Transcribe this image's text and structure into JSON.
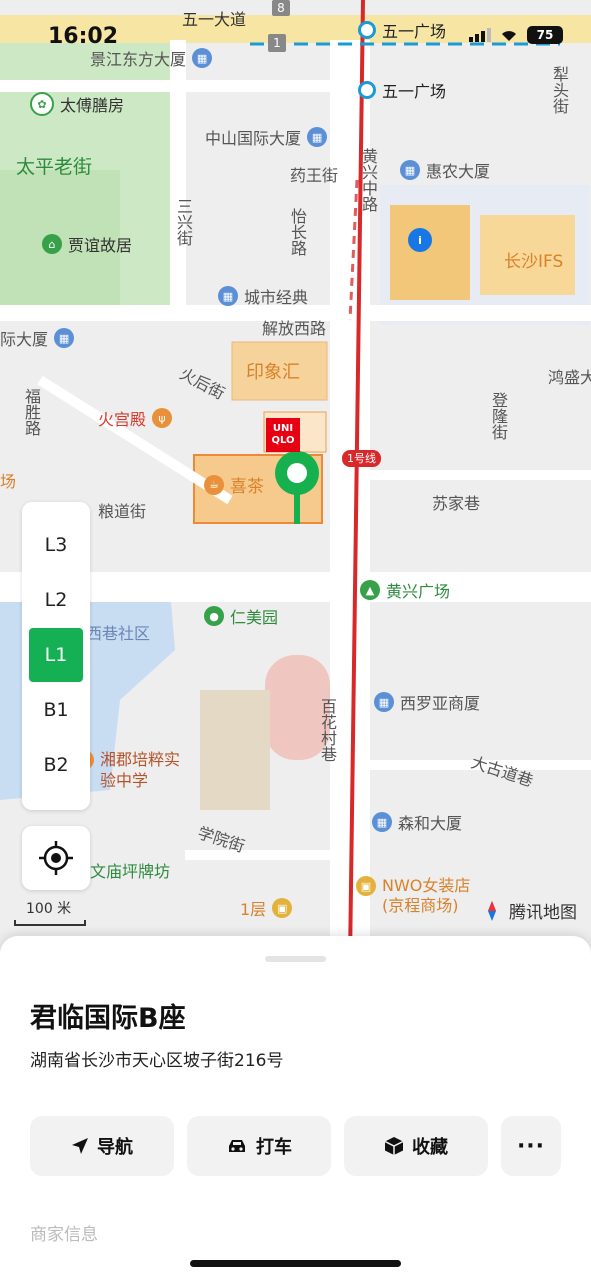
{
  "status_bar": {
    "time": "16:02",
    "battery": "75"
  },
  "map": {
    "roads": {
      "wuyi_road": "五一大道",
      "jiefang_west": "解放西路",
      "huangxing_middle": "黄兴中路",
      "yaowang": "药王街",
      "yichang": "怡长路",
      "sanxing": "三兴街",
      "huohou": "火后街",
      "fusheng": "福胜路",
      "liangdao": "粮道街",
      "dengzhong": "登隆街",
      "sujia": "苏家巷",
      "baihuacun": "百花村巷",
      "xueyuan": "学院街",
      "dagudao": "大古道巷",
      "litou": "犁头街",
      "line1": "1号线"
    },
    "pois": {
      "jingjiang": "景江东方大厦",
      "wuyi_square_1": "五一广场",
      "wuyi_square_2": "五一广场",
      "taifu": "太傅膳房",
      "taiping": "太平老街",
      "zhongshan": "中山国际大厦",
      "huinong": "惠农大厦",
      "jiayi": "贾谊故居",
      "ifs": "长沙IFS",
      "chengshi": "城市经典",
      "dasha_left": "际大厦",
      "yinxianghui": "印象汇",
      "honggong": "鸿盛大",
      "huogongdian": "火宫殿",
      "xicha": "喜茶",
      "uniqlo": "UNI QLO",
      "huangxing_square": "黄兴广场",
      "renmei": "仁美园",
      "xixiang": "西巷社区",
      "xiluoya": "西罗亚商厦",
      "xiangjun": "湘郡培粹实验中学",
      "senhe": "森和大厦",
      "wenmiao": "文庙坪牌坊",
      "nwo": "NWO女装店 (京程商场)",
      "floor1": "1层",
      "left_edge": "场"
    },
    "road_shields": [
      "8",
      "1"
    ],
    "floors": [
      "L3",
      "L2",
      "L1",
      "B1",
      "B2"
    ],
    "active_floor": "L1",
    "scale": "100 米",
    "brand": "腾讯地图",
    "colors": {
      "accent": "#15b054",
      "metro_line": "#d8282a",
      "building": "#f3c77a",
      "park": "#cde8c4",
      "water": "#c8dcf2"
    }
  },
  "place": {
    "name": "君临国际B座",
    "address": "湖南省长沙市天心区坡子街216号",
    "actions": {
      "navigate": "导航",
      "taxi": "打车",
      "favorite": "收藏",
      "more": "···"
    },
    "section": "商家信息"
  }
}
